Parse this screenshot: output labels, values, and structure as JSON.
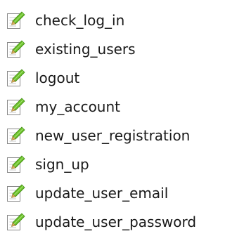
{
  "files": [
    {
      "name": "check_log_in",
      "icon": "text-document-icon"
    },
    {
      "name": "existing_users",
      "icon": "text-document-icon"
    },
    {
      "name": "logout",
      "icon": "text-document-icon"
    },
    {
      "name": "my_account",
      "icon": "text-document-icon"
    },
    {
      "name": "new_user_registration",
      "icon": "text-document-icon"
    },
    {
      "name": "sign_up",
      "icon": "text-document-icon"
    },
    {
      "name": "update_user_email",
      "icon": "text-document-icon"
    },
    {
      "name": "update_user_password",
      "icon": "text-document-icon"
    }
  ],
  "colors": {
    "page_background": "#ffffff",
    "label_text": "#1a1a1a",
    "page_border": "#8a8a8a",
    "pencil_green": "#6cc12b",
    "pencil_tip": "#d9b25b"
  }
}
